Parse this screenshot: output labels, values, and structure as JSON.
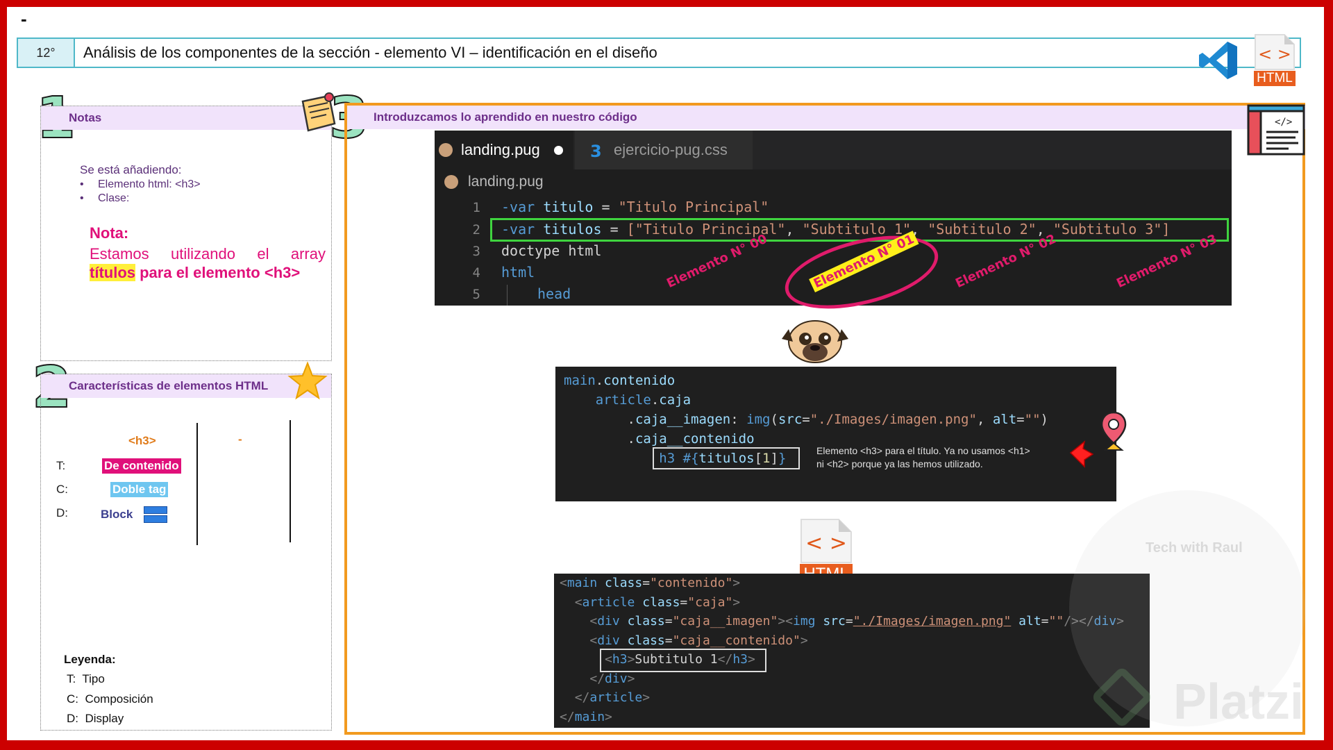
{
  "header": {
    "dash": "-",
    "number": "12°",
    "title": "Análisis de los componentes de la sección   - elemento VI – identificación en el diseño",
    "html_badge": "HTML"
  },
  "section1": {
    "number": "1",
    "title": "Notas",
    "intro": "Se está añadiendo:",
    "items": [
      "Elemento html: <h3>",
      "Clase:"
    ],
    "nota_title": "Nota:",
    "nota_text": "Estamos utilizando el array",
    "nota_highlight": "títulos",
    "nota_rest": " para el elemento <h3>"
  },
  "section2": {
    "number": "2",
    "title": "Características de elementos HTML",
    "col1_header": "<h3>",
    "col2_header": "-",
    "row_labels": [
      "T:",
      "C:",
      "D:"
    ],
    "tipo_value": "De contenido",
    "composicion_value": "Doble tag",
    "display_value": "Block",
    "legend_title": "Leyenda:",
    "legend": [
      {
        "key": "T:",
        "value": "Tipo"
      },
      {
        "key": "C:",
        "value": "Composición"
      },
      {
        "key": "D:",
        "value": "Display"
      }
    ]
  },
  "section3": {
    "number": "3",
    "title": "Introduzcamos lo aprendido en nuestro código",
    "editor": {
      "tab_active": "landing.pug",
      "tab_other": "ejercicio-pug.css",
      "breadcrumb": "landing.pug",
      "line_numbers": [
        "1",
        "2",
        "3",
        "4",
        "5"
      ]
    },
    "element_labels": [
      "Elemento N° 00",
      "Elemento N° 01",
      "Elemento N° 02",
      "Elemento N° 03"
    ],
    "note_line1": "Elemento <h3> para el título. Ya no usamos <h1>",
    "note_line2": "ni <h2> porque ya las hemos utilizado.",
    "html_badge": "HTML"
  },
  "watermark": {
    "brand": "Platzi",
    "tech": "Tech with Raul"
  },
  "colors": {
    "frame": "#cc0000",
    "accent_orange": "#f29a1f",
    "pink": "#e0107a",
    "teal": "#4eb8c8"
  }
}
